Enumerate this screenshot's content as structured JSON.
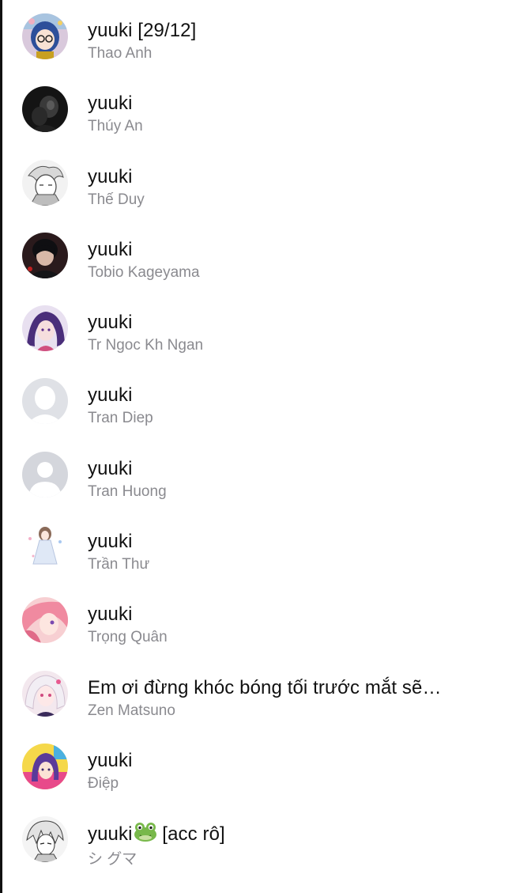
{
  "conversations": [
    {
      "title": "yuuki [29/12]",
      "subtitle": "Thao Anh",
      "avatar": "anime-girl-glasses-avatar"
    },
    {
      "title": "yuuki",
      "subtitle": "Thúy An",
      "avatar": "dark-photo-avatar"
    },
    {
      "title": "yuuki",
      "subtitle": "Thế Duy",
      "avatar": "manga-sketch-avatar"
    },
    {
      "title": "yuuki",
      "subtitle": "Tobio Kageyama",
      "avatar": "dark-hair-boy-avatar"
    },
    {
      "title": "yuuki",
      "subtitle": "Tr Ngoc Kh Ngan",
      "avatar": "purple-hair-girl-avatar"
    },
    {
      "title": "yuuki",
      "subtitle": "Tran Diep",
      "avatar": "default-person-avatar"
    },
    {
      "title": "yuuki",
      "subtitle": "Tran Huong",
      "avatar": "default-person-avatar"
    },
    {
      "title": "yuuki",
      "subtitle": "Trần Thư",
      "avatar": "chibi-girl-dress-avatar"
    },
    {
      "title": "yuuki",
      "subtitle": "Trọng Quân",
      "avatar": "pink-hair-girl-avatar"
    },
    {
      "title": "Em ơi đừng khóc bóng tối trước mắt sẽ…",
      "subtitle": "Zen Matsuno",
      "avatar": "white-hair-girl-avatar"
    },
    {
      "title": "yuuki",
      "subtitle": "Điệp",
      "avatar": "colorful-anime-avatar"
    },
    {
      "title": "yuuki",
      "title_suffix": " [acc rô]",
      "subtitle": "シ グマ",
      "avatar": "manga-boy-sketch-avatar",
      "emoji": "frog-emoji"
    }
  ]
}
